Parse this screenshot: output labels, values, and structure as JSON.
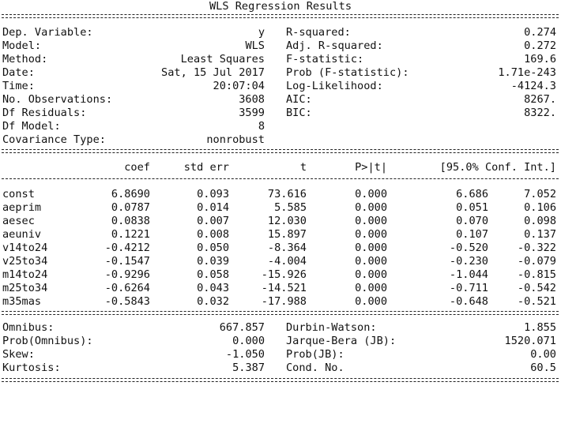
{
  "title": "WLS Regression Results",
  "model_info": [
    {
      "label": "Dep. Variable:",
      "value": "y",
      "label2": "R-squared:",
      "value2": "0.274"
    },
    {
      "label": "Model:",
      "value": "WLS",
      "label2": "Adj. R-squared:",
      "value2": "0.272"
    },
    {
      "label": "Method:",
      "value": "Least Squares",
      "label2": "F-statistic:",
      "value2": "169.6"
    },
    {
      "label": "Date:",
      "value": "Sat, 15 Jul 2017",
      "label2": "Prob (F-statistic):",
      "value2": "1.71e-243"
    },
    {
      "label": "Time:",
      "value": "20:07:04",
      "label2": "Log-Likelihood:",
      "value2": "-4124.3"
    },
    {
      "label": "No. Observations:",
      "value": "3608",
      "label2": "AIC:",
      "value2": "8267."
    },
    {
      "label": "Df Residuals:",
      "value": "3599",
      "label2": "BIC:",
      "value2": "8322."
    },
    {
      "label": "Df Model:",
      "value": "8",
      "label2": "",
      "value2": ""
    },
    {
      "label": "Covariance Type:",
      "value": "nonrobust",
      "label2": "",
      "value2": ""
    }
  ],
  "coef_table": {
    "headers": [
      "",
      "coef",
      "std err",
      "t",
      "P>|t|",
      "[95.0% Conf. Int.]"
    ],
    "rows": [
      {
        "name": "const",
        "coef": "6.8690",
        "std_err": "0.093",
        "t": "73.616",
        "p": "0.000",
        "ci_low": "6.686",
        "ci_high": "7.052"
      },
      {
        "name": "aeprim",
        "coef": "0.0787",
        "std_err": "0.014",
        "t": "5.585",
        "p": "0.000",
        "ci_low": "0.051",
        "ci_high": "0.106"
      },
      {
        "name": "aesec",
        "coef": "0.0838",
        "std_err": "0.007",
        "t": "12.030",
        "p": "0.000",
        "ci_low": "0.070",
        "ci_high": "0.098"
      },
      {
        "name": "aeuniv",
        "coef": "0.1221",
        "std_err": "0.008",
        "t": "15.897",
        "p": "0.000",
        "ci_low": "0.107",
        "ci_high": "0.137"
      },
      {
        "name": "v14to24",
        "coef": "-0.4212",
        "std_err": "0.050",
        "t": "-8.364",
        "p": "0.000",
        "ci_low": "-0.520",
        "ci_high": "-0.322"
      },
      {
        "name": "v25to34",
        "coef": "-0.1547",
        "std_err": "0.039",
        "t": "-4.004",
        "p": "0.000",
        "ci_low": "-0.230",
        "ci_high": "-0.079"
      },
      {
        "name": "m14to24",
        "coef": "-0.9296",
        "std_err": "0.058",
        "t": "-15.926",
        "p": "0.000",
        "ci_low": "-1.044",
        "ci_high": "-0.815"
      },
      {
        "name": "m25to34",
        "coef": "-0.6264",
        "std_err": "0.043",
        "t": "-14.521",
        "p": "0.000",
        "ci_low": "-0.711",
        "ci_high": "-0.542"
      },
      {
        "name": "m35mas",
        "coef": "-0.5843",
        "std_err": "0.032",
        "t": "-17.988",
        "p": "0.000",
        "ci_low": "-0.648",
        "ci_high": "-0.521"
      }
    ]
  },
  "diagnostics": [
    {
      "label": "Omnibus:",
      "value": "667.857",
      "label2": "Durbin-Watson:",
      "value2": "1.855"
    },
    {
      "label": "Prob(Omnibus):",
      "value": "0.000",
      "label2": "Jarque-Bera (JB):",
      "value2": "1520.071"
    },
    {
      "label": "Skew:",
      "value": "-1.050",
      "label2": "Prob(JB):",
      "value2": "0.00"
    },
    {
      "label": "Kurtosis:",
      "value": "5.387",
      "label2": "Cond. No.",
      "value2": "60.5"
    }
  ]
}
